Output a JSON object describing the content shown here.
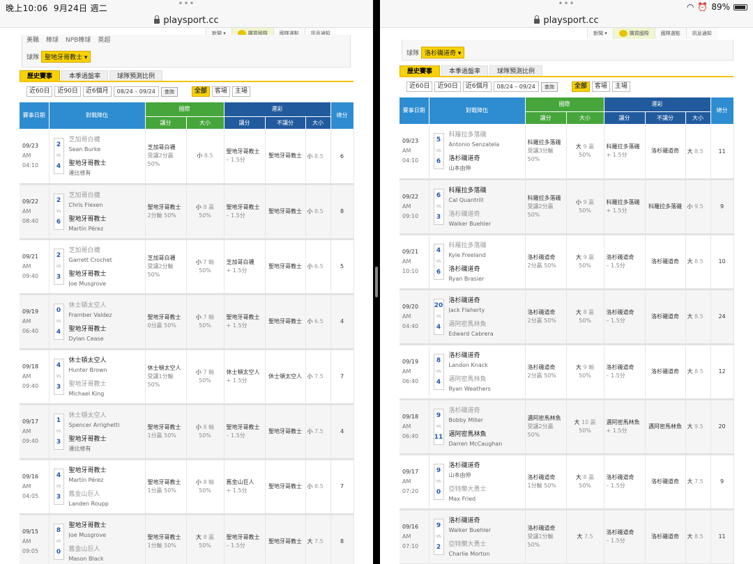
{
  "status": {
    "time": "晚上10:06",
    "date": "9月24日 週二",
    "battery": "89%",
    "dots": "•••"
  },
  "left": {
    "url": "playsport.cc",
    "nav": [
      "新聞 ▾",
      "購買國際",
      "國隊選點",
      "訊息通知"
    ],
    "filter": {
      "row1": [
        "美職",
        "棒球",
        "NPB棒球",
        "英超"
      ],
      "team_label": "球隊",
      "team_value": "聖地牙哥教士 ▾"
    },
    "tabs": [
      "歷史賽事",
      "本季過盤率",
      "球隊預測比例"
    ],
    "ranges": [
      "近60日",
      "近90日",
      "近6個月"
    ],
    "date_from": "08/24",
    "date_to": "09/24",
    "date_sep": "–",
    "query": "查詢",
    "scope": [
      "全部",
      "客場",
      "主場"
    ],
    "head": {
      "date": "賽事日期",
      "matchup": "對戰陣伍",
      "intl": "國際",
      "lottery": "運彩",
      "spread": "讓分",
      "ou": "大小",
      "nospread": "不讓分",
      "count": "總分"
    },
    "rows": [
      {
        "d": "09/23",
        "ap": "AM",
        "t": "04:10",
        "s1": "2",
        "s2": "4",
        "a": "芝加哥白襪",
        "ap1": "Sean Burke",
        "h": "聖地牙哥教士",
        "hp1": "達比修有",
        "win": "h",
        "is1": "芝加哥白襪",
        "is2": "受讓2分贏",
        "is3": "50%",
        "ob": "小",
        "on": "8.5",
        "or": "",
        "op": "",
        "ls1": "聖地牙哥教士",
        "ls2": "– 1.5分",
        "nl": "聖地牙哥教士",
        "lob": "小",
        "lon": "8.5",
        "tot": "6"
      },
      {
        "d": "09/22",
        "ap": "AM",
        "t": "08:40",
        "s1": "2",
        "s2": "6",
        "a": "芝加哥白襪",
        "ap1": "Chris Flexen",
        "h": "聖地牙哥教士",
        "hp1": "Martín Pérez",
        "win": "h",
        "is1": "聖地牙哥教士",
        "is2": "2分輸 50%",
        "is3": "",
        "ob": "小",
        "on": "8",
        "or": "贏",
        "op": "50%",
        "ls1": "聖地牙哥教士",
        "ls2": "– 1.5分",
        "nl": "聖地牙哥教士",
        "lob": "小",
        "lon": "8.5",
        "tot": "8"
      },
      {
        "d": "09/21",
        "ap": "AM",
        "t": "09:40",
        "s1": "2",
        "s2": "3",
        "a": "芝加哥白襪",
        "ap1": "Garrett Crochet",
        "h": "聖地牙哥教士",
        "hp1": "Joe Musgrove",
        "win": "h",
        "is1": "芝加哥白襪",
        "is2": "受讓2分輸",
        "is3": "50%",
        "ob": "小",
        "on": "7",
        "or": "輸",
        "op": "50%",
        "ls1": "芝加哥白襪",
        "ls2": "+ 1.5分",
        "nl": "聖地牙哥教士",
        "lob": "小",
        "lon": "6.5",
        "tot": "5"
      },
      {
        "d": "09/19",
        "ap": "AM",
        "t": "06:40",
        "s1": "0",
        "s2": "4",
        "a": "休士頓太空人",
        "ap1": "Framber Valdez",
        "h": "聖地牙哥教士",
        "hp1": "Dylan Cease",
        "win": "h",
        "is1": "聖地牙哥教士",
        "is2": "0分贏 50%",
        "is3": "",
        "ob": "小",
        "on": "7",
        "or": "輸",
        "op": "50%",
        "ls1": "聖地牙哥教士",
        "ls2": "+ 1.5分",
        "nl": "聖地牙哥教士",
        "lob": "小",
        "lon": "6.5",
        "tot": "4"
      },
      {
        "d": "09/18",
        "ap": "AM",
        "t": "09:40",
        "s1": "4",
        "s2": "3",
        "a": "休士頓太空人",
        "ap1": "Hunter Brown",
        "h": "聖地牙哥教士",
        "hp1": "Michael King",
        "win": "a",
        "is1": "休士頓太空人",
        "is2": "受讓1分輸",
        "is3": "50%",
        "ob": "小",
        "on": "7",
        "or": "輸",
        "op": "50%",
        "ls1": "休士頓太空人",
        "ls2": "+ 1.5分",
        "nl": "休士頓太空人",
        "lob": "小",
        "lon": "7.5",
        "tot": "7"
      },
      {
        "d": "09/17",
        "ap": "AM",
        "t": "09:40",
        "s1": "1",
        "s2": "3",
        "a": "休士頓太空人",
        "ap1": "Spencer Arrighetti",
        "h": "聖地牙哥教士",
        "hp1": "達比修有",
        "win": "h",
        "is1": "聖地牙哥教士",
        "is2": "1分贏 50%",
        "is3": "",
        "ob": "小",
        "on": "8",
        "or": "輸",
        "op": "50%",
        "ls1": "聖地牙哥教士",
        "ls2": "– 1.5分",
        "nl": "聖地牙哥教士",
        "lob": "小",
        "lon": "7.5",
        "tot": "4"
      },
      {
        "d": "09/16",
        "ap": "AM",
        "t": "04:05",
        "s1": "4",
        "s2": "3",
        "a": "聖地牙哥教士",
        "ap1": "Martín Pérez",
        "h": "舊金山巨人",
        "hp1": "Landen Roupp",
        "win": "a",
        "is1": "聖地牙哥教士",
        "is2": "1分贏 50%",
        "is3": "",
        "ob": "小",
        "on": "8",
        "or": "輸",
        "op": "50%",
        "ls1": "舊金山巨人",
        "ls2": "+ 1.5分",
        "nl": "聖地牙哥教士",
        "lob": "小",
        "lon": "8.5",
        "tot": "7"
      },
      {
        "d": "09/15",
        "ap": "AM",
        "t": "09:05",
        "s1": "8",
        "s2": "0",
        "a": "聖地牙哥教士",
        "ap1": "Joe Musgrove",
        "h": "舊金山巨人",
        "hp1": "Mason Black",
        "win": "a",
        "is1": "聖地牙哥教士",
        "is2": "1分輸 50%",
        "is3": "",
        "ob": "大",
        "on": "8",
        "or": "贏",
        "op": "50%",
        "ls1": "聖地牙哥教士",
        "ls2": "– 1.5分",
        "nl": "聖地牙哥教士",
        "lob": "大",
        "lon": "7.5",
        "tot": "8"
      }
    ]
  },
  "right": {
    "url": "playsport.cc",
    "nav": [
      "新聞 ▾",
      "購買國際",
      "國隊選點",
      "訊息通知"
    ],
    "filter": {
      "team_label": "球隊",
      "team_value": "洛杉磯道奇 ▾"
    },
    "tabs": [
      "歷史賽事",
      "本季過盤率",
      "球隊預測比例"
    ],
    "ranges": [
      "近60日",
      "近90日",
      "近6個月"
    ],
    "date_from": "08/24",
    "date_to": "09/24",
    "date_sep": "–",
    "query": "查詢",
    "scope": [
      "全部",
      "客場",
      "主場"
    ],
    "head": {
      "date": "賽事日期",
      "matchup": "對戰陣伍",
      "intl": "國際",
      "lottery": "運彩",
      "spread": "讓分",
      "ou": "大小",
      "nospread": "不讓分",
      "count": "總分"
    },
    "rows": [
      {
        "d": "09/23",
        "ap": "AM",
        "t": "04:10",
        "s1": "5",
        "s2": "6",
        "a": "科羅拉多落磯",
        "ap1": "Antonio Senzatela",
        "h": "洛杉磯道奇",
        "hp1": "山本由伸",
        "win": "h",
        "is1": "科羅拉多落磯",
        "is2": "受讓3分輸",
        "is3": "50%",
        "ob": "大",
        "on": "9",
        "or": "贏",
        "op": "50%",
        "ls1": "科羅拉多落磯",
        "ls2": "+ 1.5分",
        "nl": "洛杉磯道奇",
        "lob": "大",
        "lon": "8.5",
        "tot": "11"
      },
      {
        "d": "09/22",
        "ap": "AM",
        "t": "09:10",
        "s1": "6",
        "s2": "3",
        "a": "科羅拉多落磯",
        "ap1": "Cal Quantrill",
        "h": "洛杉磯道奇",
        "hp1": "Walker Buehler",
        "win": "a",
        "is1": "科羅拉多落磯",
        "is2": "受讓2分贏",
        "is3": "50%",
        "ob": "小",
        "on": "9",
        "or": "贏",
        "op": "50%",
        "ls1": "科羅拉多落磯",
        "ls2": "+ 1.5分",
        "nl": "科羅拉多落磯",
        "lob": "小",
        "lon": "9.5",
        "tot": "9"
      },
      {
        "d": "09/21",
        "ap": "AM",
        "t": "10:10",
        "s1": "4",
        "s2": "6",
        "a": "科羅拉多落磯",
        "ap1": "Kyle Freeland",
        "h": "洛杉磯道奇",
        "hp1": "Ryan Brasier",
        "win": "h",
        "is1": "洛杉磯道奇",
        "is2": "2分贏 50%",
        "is3": "",
        "ob": "大",
        "on": "9",
        "or": "贏",
        "op": "50%",
        "ls1": "洛杉磯道奇",
        "ls2": "– 1.5分",
        "nl": "洛杉磯道奇",
        "lob": "大",
        "lon": "8.5",
        "tot": "10"
      },
      {
        "d": "09/20",
        "ap": "AM",
        "t": "04:40",
        "s1": "20",
        "s2": "4",
        "a": "洛杉磯道奇",
        "ap1": "Jack Flaherty",
        "h": "邁阿密馬林魚",
        "hp1": "Edward Cabrera",
        "win": "a",
        "is1": "洛杉磯道奇",
        "is2": "2分贏 50%",
        "is3": "",
        "ob": "大",
        "on": "8",
        "or": "贏",
        "op": "50%",
        "ls1": "洛杉磯道奇",
        "ls2": "– 1.5分",
        "nl": "洛杉磯道奇",
        "lob": "大",
        "lon": "8.5",
        "tot": "24"
      },
      {
        "d": "09/19",
        "ap": "AM",
        "t": "06:40",
        "s1": "8",
        "s2": "4",
        "a": "洛杉磯道奇",
        "ap1": "Landon Knack",
        "h": "邁阿密馬林魚",
        "hp1": "Ryan Weathers",
        "win": "a",
        "is1": "洛杉磯道奇",
        "is2": "2分贏 50%",
        "is3": "",
        "ob": "大",
        "on": "9",
        "or": "輸",
        "op": "50%",
        "ls1": "洛杉磯道奇",
        "ls2": "– 1.5分",
        "nl": "洛杉磯道奇",
        "lob": "大",
        "lon": "8.5",
        "tot": "12"
      },
      {
        "d": "09/18",
        "ap": "AM",
        "t": "06:40",
        "s1": "9",
        "s2": "11",
        "a": "洛杉磯道奇",
        "ap1": "Bobby Miller",
        "h": "邁阿密馬林魚",
        "hp1": "Darren McCaughan",
        "win": "h",
        "is1": "邁阿密馬林魚",
        "is2": "受讓2分贏",
        "is3": "50%",
        "ob": "大",
        "on": "10",
        "or": "贏",
        "op": "50%",
        "ls1": "邁阿密馬林魚",
        "ls2": "+ 1.5分",
        "nl": "邁阿密馬林魚",
        "lob": "大",
        "lon": "9.5",
        "tot": "20"
      },
      {
        "d": "09/17",
        "ap": "AM",
        "t": "07:20",
        "s1": "9",
        "s2": "0",
        "a": "洛杉磯道奇",
        "ap1": "山本由伸",
        "h": "亞特蘭大勇士",
        "hp1": "Max Fried",
        "win": "a",
        "is1": "洛杉磯道奇",
        "is2": "1分輸 50%",
        "is3": "",
        "ob": "大",
        "on": "8",
        "or": "贏",
        "op": "50%",
        "ls1": "洛杉磯道奇",
        "ls2": "– 1.5分",
        "nl": "洛杉磯道奇",
        "lob": "大",
        "lon": "7.5",
        "tot": "9"
      },
      {
        "d": "09/16",
        "ap": "AM",
        "t": "07:10",
        "s1": "9",
        "s2": "2",
        "a": "洛杉磯道奇",
        "ap1": "Walker Buehler",
        "h": "亞特蘭大勇士",
        "hp1": "Charlie Morton",
        "win": "a",
        "is1": "洛杉磯道奇",
        "is2": "受讓1分輸",
        "is3": "50%",
        "ob": "大",
        "on": "7.5",
        "or": "",
        "op": "",
        "ls1": "洛杉磯道奇",
        "ls2": "– 1.5分",
        "nl": "洛杉磯道奇",
        "lob": "大",
        "lon": "8.5",
        "tot": "11"
      }
    ]
  }
}
